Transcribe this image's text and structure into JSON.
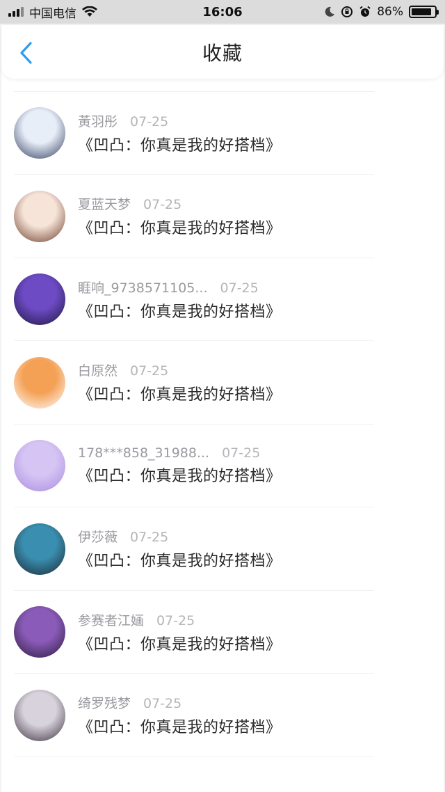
{
  "status_bar": {
    "carrier": "中国电信",
    "time": "16:06",
    "battery": "86%",
    "battery_level": 0.86
  },
  "header": {
    "title": "收藏"
  },
  "items": [
    {
      "name": "",
      "date": "",
      "message": "《凹凸：你真是我的好搭档》",
      "avatar_colors": [
        "#c9d6f3",
        "#8a94c8"
      ]
    },
    {
      "name": "黃羽彤",
      "date": "07-25",
      "message": "《凹凸：你真是我的好搭档》",
      "avatar_colors": [
        "#e8eef8",
        "#2d3a5c"
      ]
    },
    {
      "name": "夏蓝天梦",
      "date": "07-25",
      "message": "《凹凸：你真是我的好搭档》",
      "avatar_colors": [
        "#f6e4d8",
        "#6b3b27"
      ]
    },
    {
      "name": "睚响_9738571105...",
      "date": "07-25",
      "message": "《凹凸：你真是我的好搭档》",
      "avatar_colors": [
        "#6d4bc4",
        "#1e1540"
      ]
    },
    {
      "name": "白原然",
      "date": "07-25",
      "message": "《凹凸：你真是我的好搭档》",
      "avatar_colors": [
        "#f4a055",
        "#ffffff"
      ]
    },
    {
      "name": "178***858_31988...",
      "date": "07-25",
      "message": "《凹凸：你真是我的好搭档》",
      "avatar_colors": [
        "#d6c4f4",
        "#a98be0"
      ]
    },
    {
      "name": "伊莎薇",
      "date": "07-25",
      "message": "《凹凸：你真是我的好搭档》",
      "avatar_colors": [
        "#3a8fb0",
        "#1b2633"
      ]
    },
    {
      "name": "参赛者江婳",
      "date": "07-25",
      "message": "《凹凸：你真是我的好搭档》",
      "avatar_colors": [
        "#8a5bb8",
        "#2a1a3c"
      ]
    },
    {
      "name": "绮罗残梦",
      "date": "07-25",
      "message": "《凹凸：你真是我的好搭档》",
      "avatar_colors": [
        "#d8d2dc",
        "#3a2f3c"
      ]
    }
  ]
}
